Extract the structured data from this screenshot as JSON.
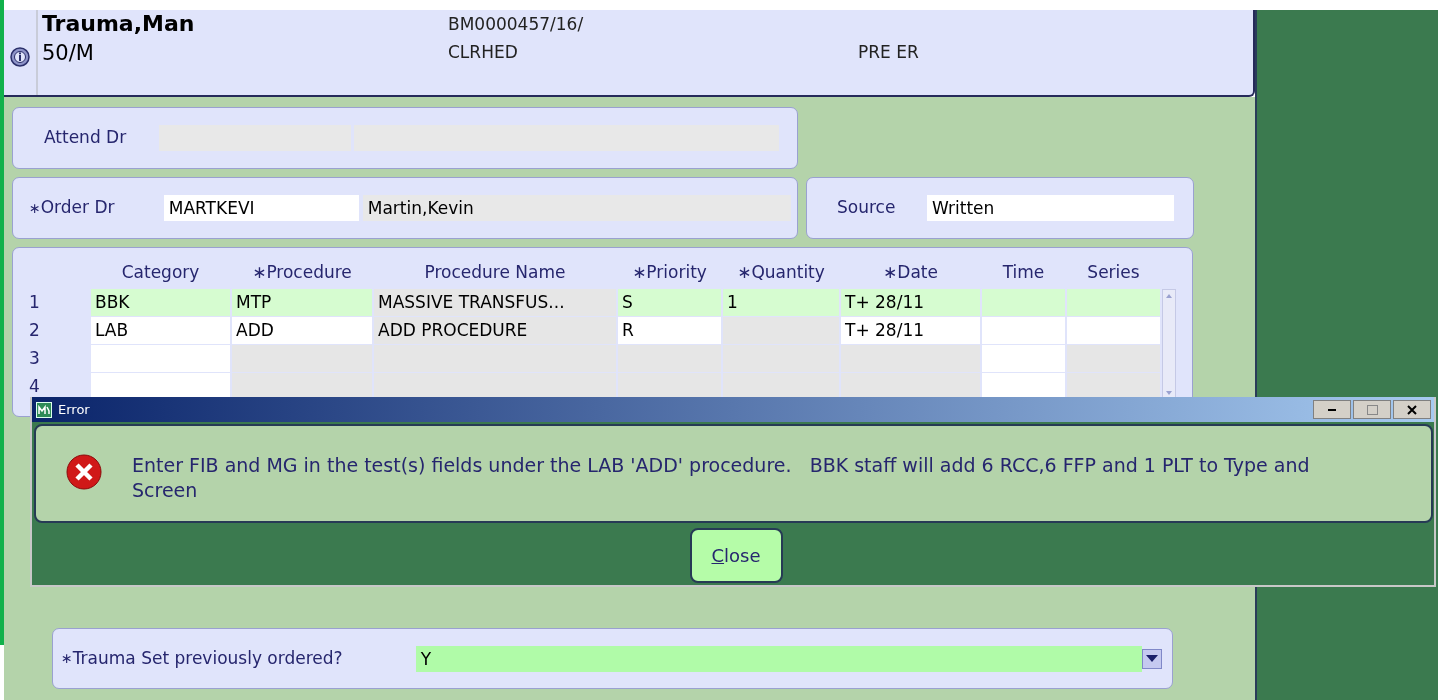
{
  "patient": {
    "name": "Trauma,Man",
    "age_sex": "50/M",
    "account": "BM0000457/16/",
    "location": "CLRHED",
    "status": "PRE ER"
  },
  "attend_dr": {
    "label": "Attend Dr"
  },
  "order_dr": {
    "label": "Order Dr",
    "required_mark": "∗",
    "code": "MARTKEVI",
    "name": "Martin,Kevin"
  },
  "source": {
    "label": "Source",
    "value": "Written"
  },
  "table": {
    "columns": [
      {
        "label": "Category"
      },
      {
        "label": "Procedure",
        "required_mark": "∗"
      },
      {
        "label": "Procedure Name"
      },
      {
        "label": "Priority",
        "required_mark": "∗"
      },
      {
        "label": "Quantity",
        "required_mark": "∗"
      },
      {
        "label": "Date",
        "required_mark": "∗"
      },
      {
        "label": "Time"
      },
      {
        "label": "Series"
      }
    ],
    "rows": [
      {
        "number": "1",
        "selected": true,
        "cells": [
          {
            "text": "BBK",
            "editable": true
          },
          {
            "text": "MTP",
            "editable": true
          },
          {
            "text": "MASSIVE TRANSFUS...",
            "editable": false
          },
          {
            "text": "S",
            "editable": true
          },
          {
            "text": "1",
            "editable": true
          },
          {
            "text": "T+   28/11",
            "editable": true
          },
          {
            "editable": true
          },
          {
            "editable": true
          }
        ]
      },
      {
        "number": "2",
        "selected": false,
        "cells": [
          {
            "text": "LAB",
            "editable": true
          },
          {
            "text": "ADD",
            "editable": true
          },
          {
            "text": "ADD PROCEDURE",
            "editable": false
          },
          {
            "text": "R",
            "editable": true
          },
          {
            "editable": false
          },
          {
            "text": "T+   28/11",
            "editable": true
          },
          {
            "editable": true
          },
          {
            "editable": true
          }
        ]
      },
      {
        "number": "3",
        "selected": false,
        "cells": [
          {
            "editable": true
          },
          {
            "editable": false
          },
          {
            "editable": false
          },
          {
            "editable": false
          },
          {
            "editable": false
          },
          {
            "editable": false
          },
          {
            "editable": true
          },
          {
            "editable": false
          }
        ]
      },
      {
        "number": "4",
        "selected": false,
        "cells": [
          {
            "editable": true
          },
          {
            "editable": false
          },
          {
            "editable": false
          },
          {
            "editable": false
          },
          {
            "editable": false
          },
          {
            "editable": false
          },
          {
            "editable": true
          },
          {
            "editable": false
          }
        ]
      }
    ]
  },
  "dialog": {
    "title": "Error",
    "message": "Enter FIB and MG in the test(s) fields under the LAB 'ADD' procedure.   BBK staff will add 6 RCC,6 FFP and 1 PLT to Type and Screen",
    "button": [
      {
        "text": "C",
        "underlined": true
      },
      {
        "text": "lose",
        "underlined": false
      }
    ]
  },
  "trauma_set": {
    "label": "Trauma Set previously ordered?",
    "required_mark": "∗",
    "value": "Y"
  }
}
